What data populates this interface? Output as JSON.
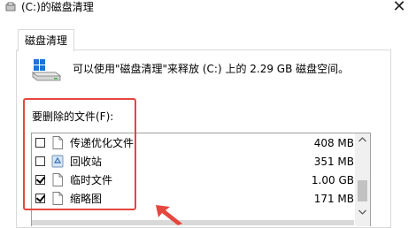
{
  "window": {
    "title": "(C:)的磁盘清理",
    "close_glyph": "✕"
  },
  "tab": {
    "label": "磁盘清理"
  },
  "info": {
    "text": "可以使用\"磁盘清理\"来释放  (C:) 上的 2.29 GB 磁盘空间。"
  },
  "files_label": "要删除的文件(F):",
  "files": [
    {
      "name": "传递优化文件",
      "size": "408 MB",
      "checked": false,
      "icon": "file-icon"
    },
    {
      "name": "回收站",
      "size": "351 MB",
      "checked": false,
      "icon": "recycle-bin-icon"
    },
    {
      "name": "临时文件",
      "size": "1.00 GB",
      "checked": true,
      "icon": "file-icon"
    },
    {
      "name": "缩略图",
      "size": "171 MB",
      "checked": true,
      "icon": "file-icon"
    }
  ],
  "colors": {
    "highlight": "#e4473e",
    "accent": "#1e73d6"
  }
}
